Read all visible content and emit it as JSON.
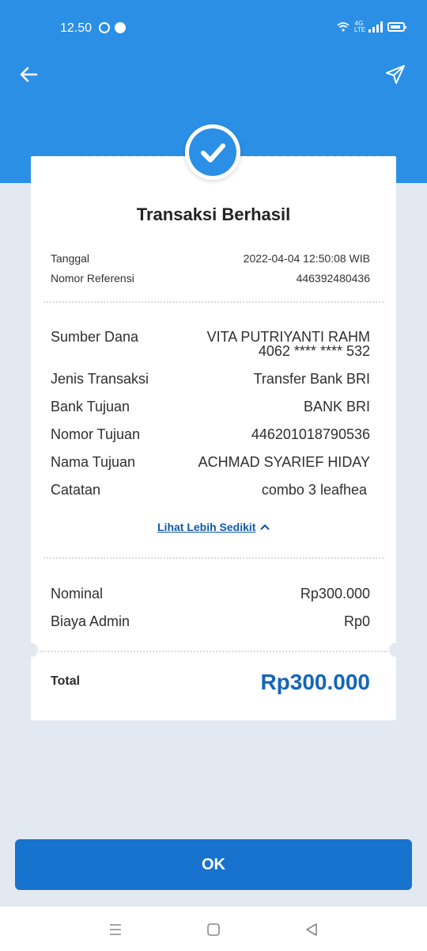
{
  "status_bar": {
    "time": "12.50",
    "network": "4G LTE"
  },
  "receipt": {
    "title": "Transaksi Berhasil",
    "meta": [
      {
        "label": "Tanggal",
        "value": "2022-04-04 12:50:08 WIB"
      },
      {
        "label": "Nomor Referensi",
        "value": "446392480436"
      }
    ],
    "details": {
      "sumber_dana": {
        "label": "Sumber Dana",
        "name": "VITA PUTRIYANTI RAHM",
        "card": "4062 **** **** 532"
      },
      "rows": [
        {
          "label": "Jenis Transaksi",
          "value": "Transfer Bank BRI"
        },
        {
          "label": "Bank Tujuan",
          "value": "BANK BRI"
        },
        {
          "label": "Nomor Tujuan",
          "value": "446201018790536"
        },
        {
          "label": "Nama Tujuan",
          "value": "ACHMAD SYARIEF HIDAY"
        },
        {
          "label": "Catatan",
          "value": "combo 3 leafhea"
        }
      ]
    },
    "toggle_link": "Lihat Lebih Sedikit",
    "amounts": [
      {
        "label": "Nominal",
        "value": "Rp300.000"
      },
      {
        "label": "Biaya Admin",
        "value": "Rp0"
      }
    ],
    "total": {
      "label": "Total",
      "value": "Rp300.000"
    }
  },
  "ok_button": {
    "label": "OK"
  },
  "colors": {
    "primary": "#2b8fe6",
    "button": "#1773cd",
    "total": "#1565b7",
    "link": "#0f5aa8"
  },
  "icons": [
    "back-arrow-icon",
    "send-icon",
    "check-icon",
    "chevron-up-icon",
    "menu-icon",
    "home-square-icon",
    "back-triangle-icon"
  ]
}
